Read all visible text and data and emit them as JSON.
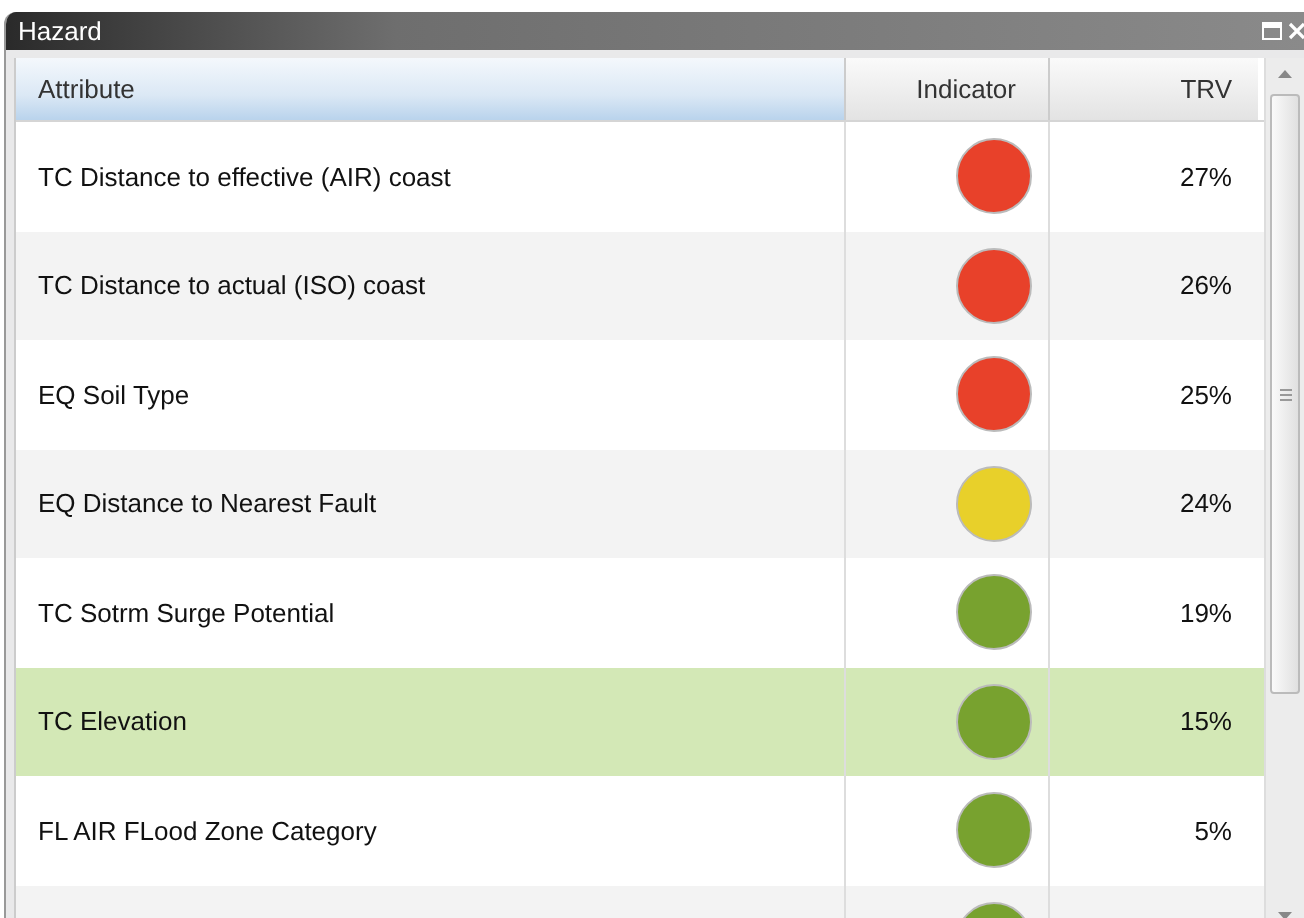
{
  "window": {
    "title": "Hazard"
  },
  "table": {
    "columns": [
      "Attribute",
      "Indicator",
      "TRV"
    ],
    "rows": [
      {
        "attribute": "TC Distance to effective (AIR) coast",
        "color": "#e8412a",
        "trv": "27%",
        "selected": false
      },
      {
        "attribute": "TC Distance to actual (ISO) coast",
        "color": "#e8412a",
        "trv": "26%",
        "selected": false
      },
      {
        "attribute": "EQ Soil Type",
        "color": "#e8412a",
        "trv": "25%",
        "selected": false
      },
      {
        "attribute": "EQ Distance to Nearest Fault",
        "color": "#e8d02a",
        "trv": "24%",
        "selected": false
      },
      {
        "attribute": "TC Sotrm Surge Potential",
        "color": "#78a22f",
        "trv": "19%",
        "selected": false
      },
      {
        "attribute": "TC Elevation",
        "color": "#78a22f",
        "trv": "15%",
        "selected": true
      },
      {
        "attribute": "FL AIR FLood Zone Category",
        "color": "#78a22f",
        "trv": "5%",
        "selected": false
      },
      {
        "color": "#78a22f",
        "selected": false
      }
    ]
  }
}
